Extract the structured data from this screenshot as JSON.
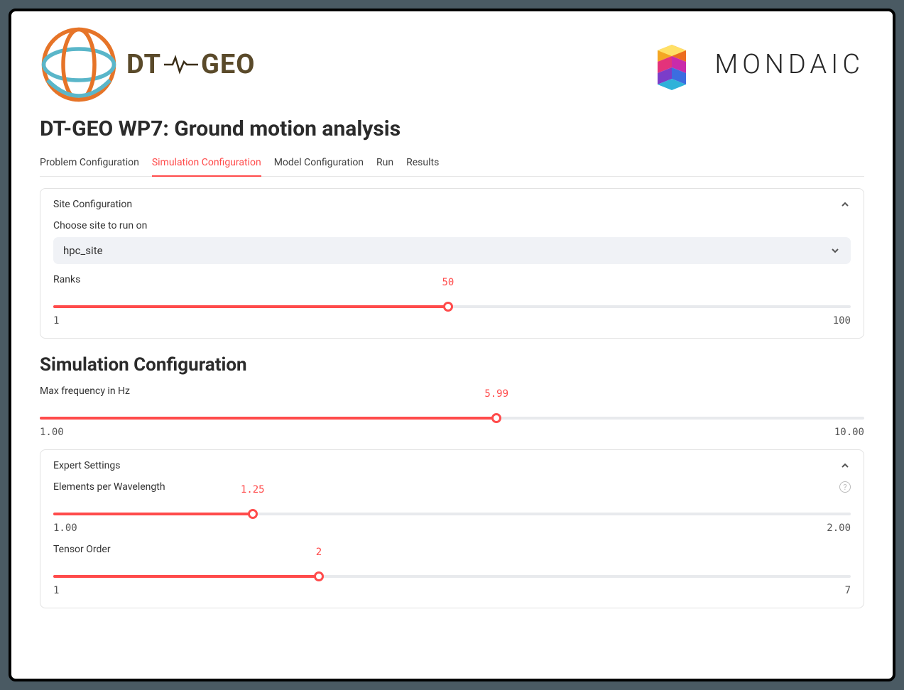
{
  "header": {
    "left_brand_prefix": "DT",
    "left_brand_suffix": "GEO",
    "right_brand": "MONDAIC"
  },
  "page_title": "DT-GEO WP7: Ground motion analysis",
  "tabs": [
    {
      "label": "Problem Configuration",
      "active": false
    },
    {
      "label": "Simulation Configuration",
      "active": true
    },
    {
      "label": "Model Configuration",
      "active": false
    },
    {
      "label": "Run",
      "active": false
    },
    {
      "label": "Results",
      "active": false
    }
  ],
  "site_config": {
    "card_title": "Site Configuration",
    "choose_label": "Choose site to run on",
    "selected_site": "hpc_site",
    "ranks_label": "Ranks",
    "ranks": {
      "min": "1",
      "max": "100",
      "value": "50",
      "percent": 49.5
    }
  },
  "sim_config": {
    "heading": "Simulation Configuration",
    "max_freq_label": "Max frequency in Hz",
    "max_freq": {
      "min": "1.00",
      "max": "10.00",
      "value": "5.99",
      "percent": 55.4
    },
    "expert_card_title": "Expert Settings",
    "epw_label": "Elements per Wavelength",
    "epw": {
      "min": "1.00",
      "max": "2.00",
      "value": "1.25",
      "percent": 25
    },
    "tensor_label": "Tensor Order",
    "tensor": {
      "min": "1",
      "max": "7",
      "value": "2",
      "percent": 33.3
    }
  }
}
